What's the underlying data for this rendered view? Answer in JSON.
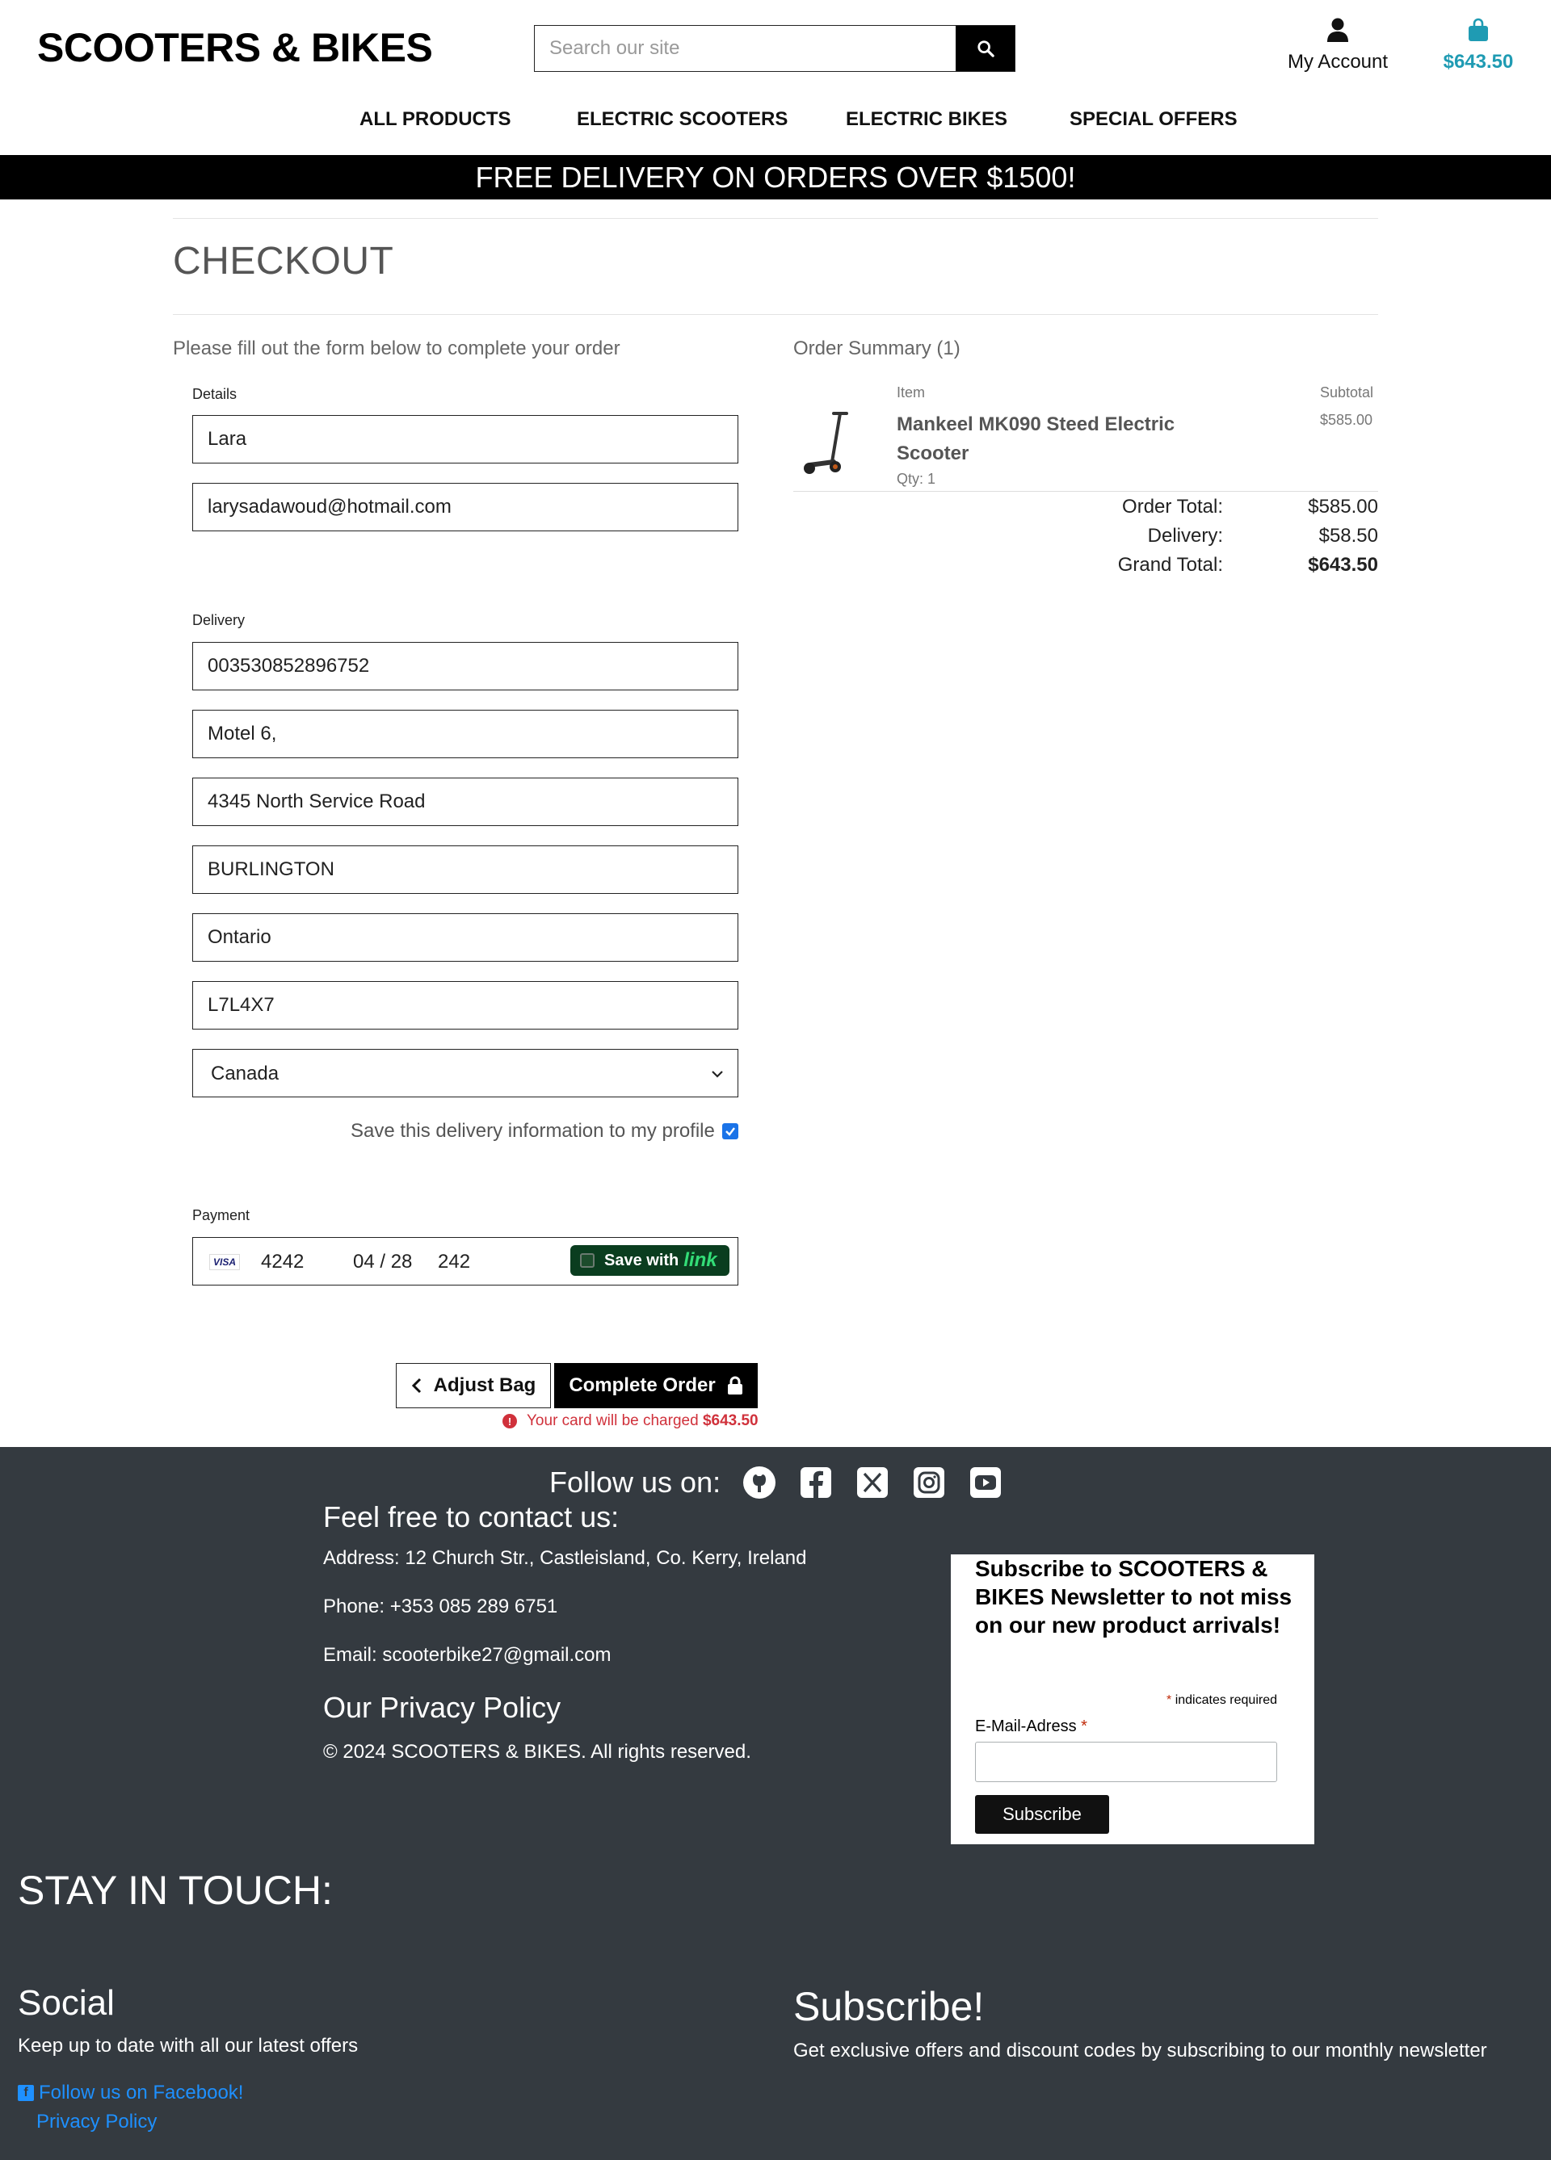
{
  "header": {
    "logo": "SCOOTERS & BIKES",
    "search_placeholder": "Search our site",
    "account_label": "My Account",
    "bag_total": "$643.50",
    "accent_color": "#1f9bb3"
  },
  "nav": {
    "items": [
      "ALL PRODUCTS",
      "ELECTRIC SCOOTERS",
      "ELECTRIC BIKES",
      "SPECIAL OFFERS"
    ]
  },
  "banner": "FREE DELIVERY ON ORDERS OVER $1500!",
  "checkout": {
    "title": "CHECKOUT",
    "intro": "Please fill out the form below to complete your order",
    "details_label": "Details",
    "full_name": "Lara",
    "email": "larysadawoud@hotmail.com",
    "delivery_label": "Delivery",
    "phone": "003530852896752",
    "address1": "Motel 6,",
    "address2": "4345 North Service Road",
    "town": "BURLINGTON",
    "county": "Ontario",
    "postcode": "L7L4X7",
    "country": "Canada",
    "save_info_label": "Save this delivery information to my profile",
    "save_info_checked": true,
    "payment_label": "Payment",
    "card": {
      "brand": "VISA",
      "number": "4242",
      "expiry": "04 / 28",
      "cvc": "242",
      "save_with": "Save with",
      "link_word": "link"
    },
    "adjust_bag": "Adjust Bag",
    "complete_order": "Complete Order",
    "charge_text": "Your card will be charged",
    "charge_amount": "$643.50"
  },
  "summary": {
    "title": "Order Summary (1)",
    "item_header": "Item",
    "subtotal_header": "Subtotal",
    "item_name": "Mankeel MK090 Steed Electric Scooter",
    "item_qty": "Qty: 1",
    "item_price": "$585.00",
    "order_total_label": "Order Total:",
    "order_total": "$585.00",
    "delivery_label": "Delivery:",
    "delivery": "$58.50",
    "grand_total_label": "Grand Total:",
    "grand_total": "$643.50"
  },
  "footer": {
    "follow": "Follow us on:",
    "social_icons": [
      "github-icon",
      "facebook-icon",
      "x-twitter-icon",
      "instagram-icon",
      "youtube-icon"
    ],
    "contact_title": "Feel free to contact us:",
    "address": "Address: 12 Church Str., Castleisland, Co. Kerry, Ireland",
    "phone": "Phone: +353 085 289 6751",
    "email": "Email: scooterbike27@gmail.com",
    "privacy_title": "Our Privacy Policy",
    "copyright": "© 2024 SCOOTERS & BIKES. All rights reserved.",
    "newsletter": {
      "title": "Subscribe to SCOOTERS & BIKES Newsletter to not miss on our new product arrivals!",
      "required_note": "indicates required",
      "email_label": "E-Mail-Adress",
      "button": "Subscribe"
    },
    "stay_in_touch": "STAY IN TOUCH:",
    "social_title": "Social",
    "social_text": "Keep up to date with all our latest offers",
    "facebook_link": "Follow us on Facebook!",
    "privacy_link": "Privacy Policy",
    "subscribe_title": "Subscribe!",
    "subscribe_text": "Get exclusive offers and discount codes by subscribing to our monthly newsletter"
  }
}
